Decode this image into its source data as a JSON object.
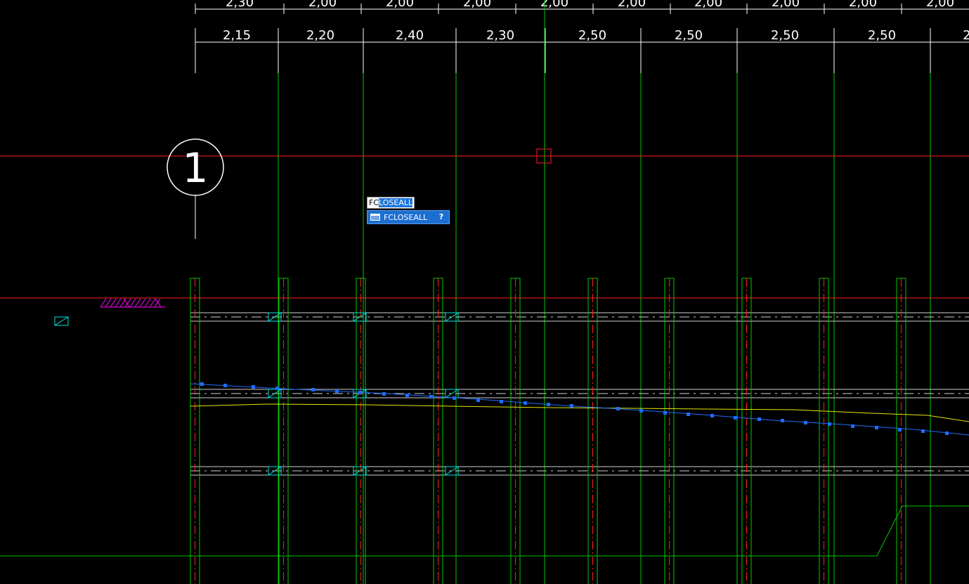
{
  "drawing": {
    "top_dimensions": [
      "2,30",
      "2,00",
      "2,00",
      "2,00",
      "2,00",
      "2,00",
      "2,00",
      "2,00",
      "2,00",
      "2,00"
    ],
    "second_dimensions": [
      "2,15",
      "2,20",
      "2,40",
      "2,30",
      "2,50",
      "2,50",
      "2,50",
      "2,50",
      "2"
    ],
    "axis_bubble_label": "1",
    "colors": {
      "background": "#000000",
      "grid_green": "#00c800",
      "red_line": "#ff2020",
      "white": "#ffffff",
      "cyan": "#00e5e5",
      "blue": "#1e6bff",
      "yellow": "#e6e600",
      "magenta": "#d000d0"
    }
  },
  "autocomplete": {
    "typed": "FC",
    "completion": "LOSEALL",
    "suggestion": "FCLOSEALL",
    "help_icon": "?"
  }
}
